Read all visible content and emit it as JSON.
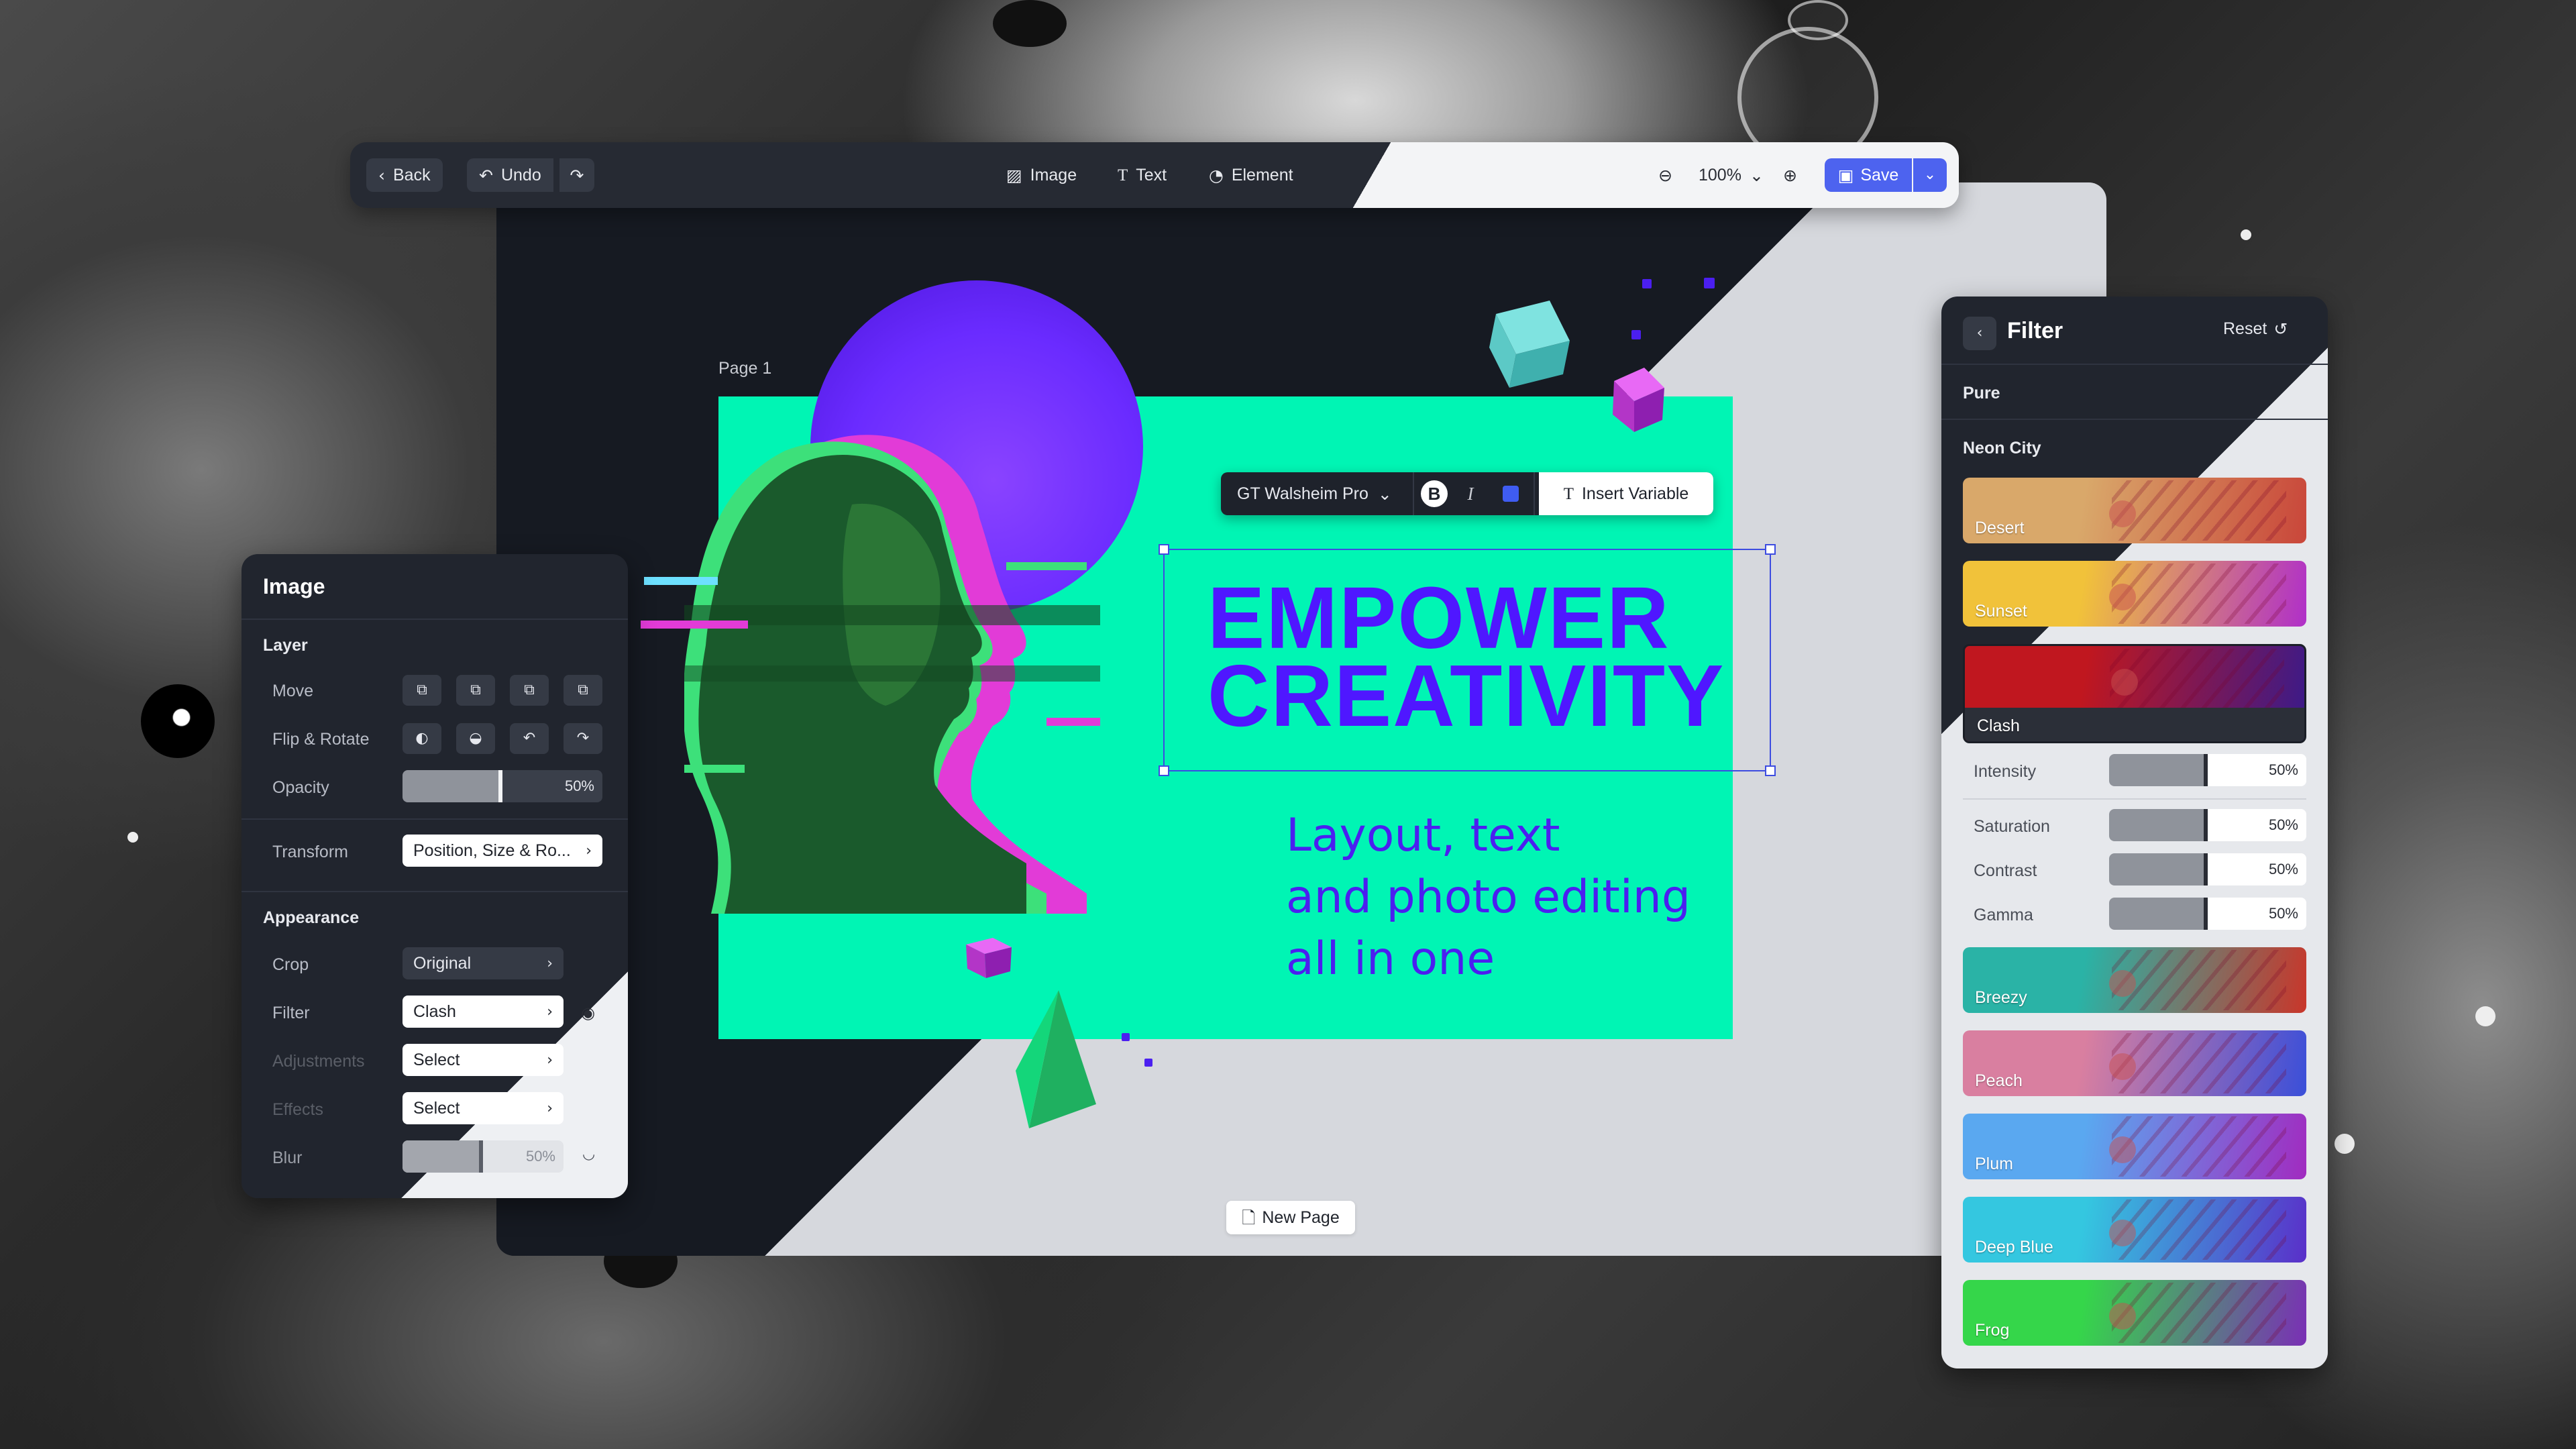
{
  "toolbar": {
    "back_label": "Back",
    "undo_label": "Undo",
    "image_label": "Image",
    "text_label": "Text",
    "element_label": "Element",
    "zoom": "100%",
    "save_label": "Save"
  },
  "canvas": {
    "page_label": "Page 1",
    "headline_line1": "EMPOWER",
    "headline_line2": "CREATIVITY",
    "subline_line1": "Layout, text",
    "subline_line2": "and photo editing",
    "subline_line3": "all in one",
    "new_page_label": "New Page"
  },
  "text_toolbar": {
    "font": "GT Walsheim Pro",
    "bold": "B",
    "italic": "I",
    "color": "#3f5cf2",
    "insert_variable": "Insert Variable"
  },
  "image_panel": {
    "title": "Image",
    "layer_heading": "Layer",
    "move_label": "Move",
    "flip_rotate_label": "Flip & Rotate",
    "opacity_label": "Opacity",
    "opacity_value": "50%",
    "opacity_fraction": 0.5,
    "transform_label": "Transform",
    "transform_value": "Position, Size & Ro...",
    "appearance_heading": "Appearance",
    "crop_label": "Crop",
    "crop_value": "Original",
    "filter_label": "Filter",
    "filter_value": "Clash",
    "adjustments_label": "Adjustments",
    "adjustments_value": "Select",
    "effects_label": "Effects",
    "effects_value": "Select",
    "blur_label": "Blur",
    "blur_value": "50%",
    "blur_fraction": 0.5
  },
  "filter_panel": {
    "title": "Filter",
    "reset_label": "Reset",
    "pure_label": "Pure",
    "neon_city_label": "Neon City",
    "filters": [
      {
        "name": "Desert",
        "colors": [
          "#d9a86a",
          "#c9463a"
        ]
      },
      {
        "name": "Sunset",
        "colors": [
          "#f1c23a",
          "#b02fc9"
        ]
      },
      {
        "name": "Clash",
        "colors": [
          "#c0171f",
          "#3a1a8a"
        ]
      },
      {
        "name": "Breezy",
        "colors": [
          "#2ab3a6",
          "#c9362a"
        ]
      },
      {
        "name": "Peach",
        "colors": [
          "#d97fa0",
          "#3a4fd9"
        ]
      },
      {
        "name": "Plum",
        "colors": [
          "#5aa8f0",
          "#a12bc0"
        ]
      },
      {
        "name": "Deep Blue",
        "colors": [
          "#34c7e0",
          "#5a2fc9"
        ]
      },
      {
        "name": "Frog",
        "colors": [
          "#35d64a",
          "#7a2fb5"
        ]
      }
    ],
    "intensity_label": "Intensity",
    "intensity_value": "50%",
    "saturation_label": "Saturation",
    "saturation_value": "50%",
    "contrast_label": "Contrast",
    "contrast_value": "50%",
    "gamma_label": "Gamma",
    "gamma_value": "50%",
    "slider_fraction": 0.5
  },
  "colors": {
    "accent": "#4d63ef",
    "page_background": "#00f5b4",
    "headline": "#4f17ff"
  }
}
